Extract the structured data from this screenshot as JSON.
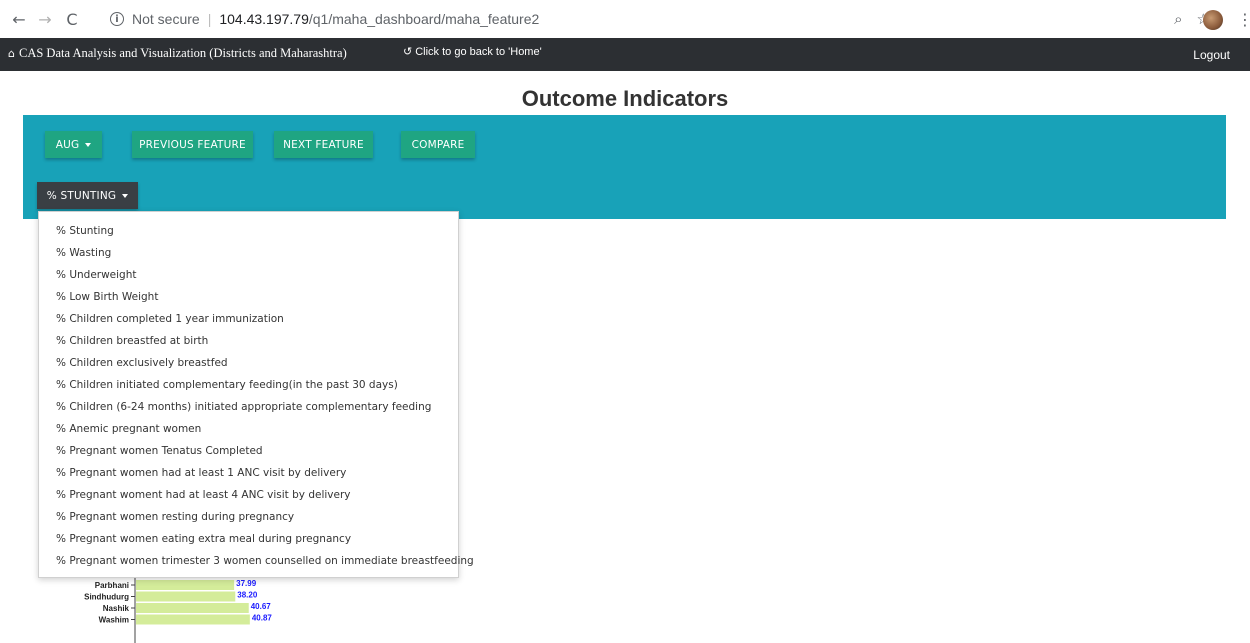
{
  "browser": {
    "back": "←",
    "forward": "→",
    "reload": "C",
    "info_icon": "i",
    "not_secure": "Not secure",
    "separator": "|",
    "url_host": "104.43.197.79",
    "url_path": "/q1/maha_dashboard/maha_feature2",
    "zoom_icon": "⌕",
    "star_icon": "☆",
    "menu_icon": "⋮"
  },
  "navbar": {
    "home_icon": "⌂",
    "brand": "CAS Data Analysis and Visualization (Districts and Maharashtra)",
    "back_icon": "↺",
    "back_link": "Click to go back to 'Home'",
    "logout": "Logout"
  },
  "page": {
    "title": "Outcome Indicators"
  },
  "toolbar": {
    "month": "AUG",
    "previous": "PREVIOUS FEATURE",
    "next": "NEXT FEATURE",
    "compare": "COMPARE",
    "indicator": "% STUNTING"
  },
  "dropdown": {
    "items": [
      "% Stunting",
      "% Wasting",
      "% Underweight",
      "% Low Birth Weight",
      "% Children completed 1 year immunization",
      "% Children breastfed at birth",
      "% Children exclusively breastfed",
      "% Children initiated complementary feeding(in the past 30 days)",
      "% Children (6-24 months) initiated appropriate complementary feeding",
      "% Anemic pregnant women",
      "% Pregnant women Tenatus Completed",
      "% Pregnant women had at least 1 ANC visit by delivery",
      "% Pregnant woment had at least 4 ANC visit by delivery",
      "% Pregnant women resting during pregnancy",
      "% Pregnant women eating extra meal during pregnancy",
      "% Pregnant women trimester 3 women counselled on immediate breastfeeding"
    ]
  },
  "colors": {
    "bar": "#d4ec9a",
    "value_label": "#1a1aff",
    "teal": "#18a2b8",
    "button": "#1fa582"
  },
  "chart_data": {
    "type": "bar",
    "orientation": "horizontal",
    "categories": [
      "Parbhani",
      "Sindhudurg",
      "Nashik",
      "Washim"
    ],
    "values": [
      37.99,
      38.2,
      40.67,
      40.87
    ],
    "labels": [
      "37.99",
      "38.20",
      "40.67",
      "40.87"
    ],
    "xlim": [
      20,
      42
    ]
  }
}
